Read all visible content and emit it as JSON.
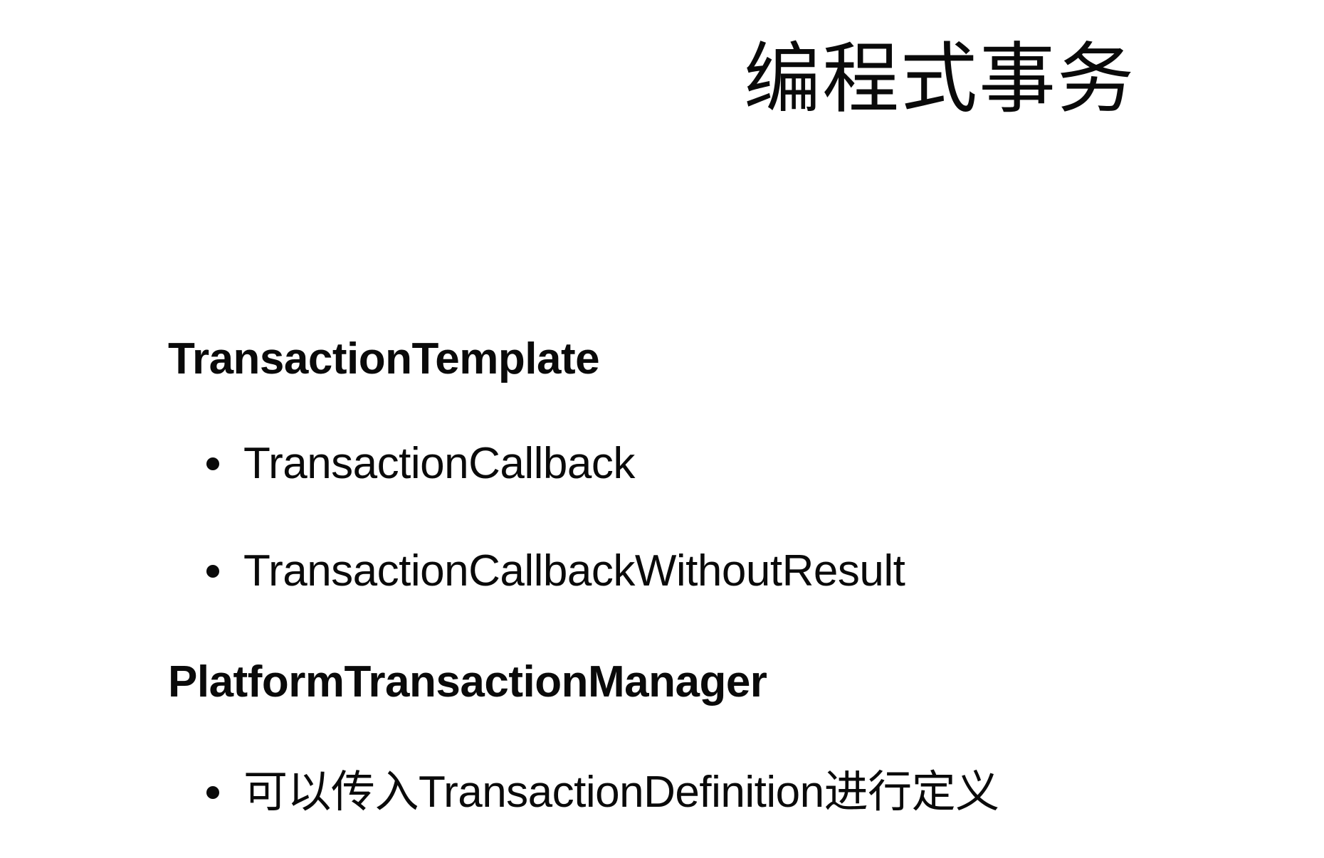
{
  "slide": {
    "title": "编程式事务",
    "sections": [
      {
        "heading": "TransactionTemplate",
        "bullets": [
          "TransactionCallback",
          "TransactionCallbackWithoutResult"
        ]
      },
      {
        "heading": "PlatformTransactionManager",
        "bullets": [
          "可以传入TransactionDefinition进行定义"
        ]
      }
    ]
  }
}
